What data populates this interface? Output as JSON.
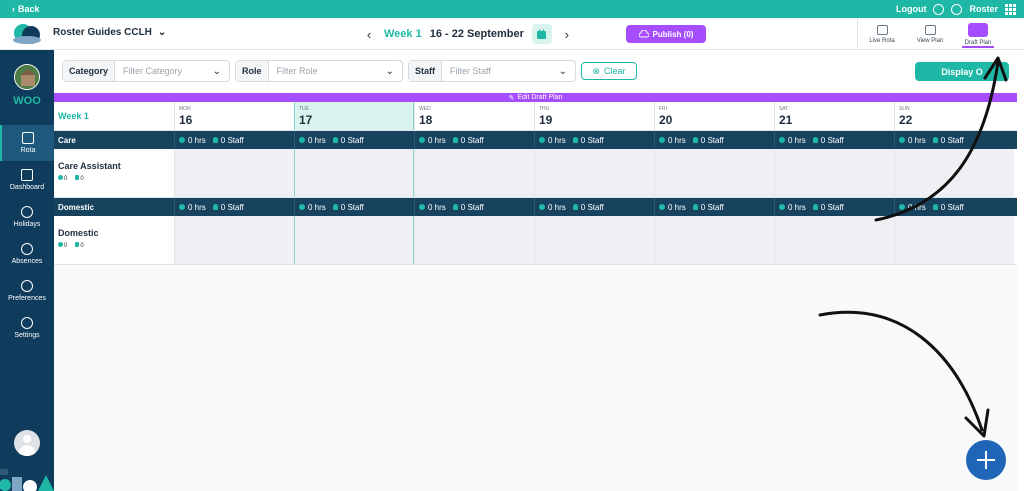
{
  "topbar": {
    "back_label": "Back",
    "logout_label": "Logout",
    "roster_label": "Roster"
  },
  "header": {
    "org_name": "Roster Guides CCLH",
    "week_label": "Week 1",
    "date_range": "16 - 22 September",
    "publish_label": "Publish (0)",
    "view_tabs": [
      {
        "label": "Live Rota",
        "active": false
      },
      {
        "label": "View Plan",
        "active": false
      },
      {
        "label": "Draft Plan",
        "active": true
      }
    ]
  },
  "sidebar": {
    "brand": "WOO",
    "items": [
      {
        "label": "Rota",
        "icon": "calendar-icon",
        "active": true
      },
      {
        "label": "Dashboard",
        "icon": "dashboard-icon",
        "active": false
      },
      {
        "label": "Holidays",
        "icon": "beach-icon",
        "active": false
      },
      {
        "label": "Absences",
        "icon": "absence-icon",
        "active": false
      },
      {
        "label": "Preferences",
        "icon": "preferences-icon",
        "active": false
      },
      {
        "label": "Settings",
        "icon": "gear-icon",
        "active": false
      }
    ]
  },
  "filters": {
    "category": {
      "label": "Category",
      "placeholder": "Filter Category"
    },
    "role": {
      "label": "Role",
      "placeholder": "Filter Role"
    },
    "staff": {
      "label": "Staff",
      "placeholder": "Filter Staff"
    },
    "clear_label": "Clear",
    "display_label": "Display O"
  },
  "draft_strip_label": "Edit Draft Plan",
  "grid": {
    "week_label": "Week 1",
    "days": [
      {
        "name": "MON",
        "num": "16"
      },
      {
        "name": "TUE",
        "num": "17"
      },
      {
        "name": "WED",
        "num": "18"
      },
      {
        "name": "THU",
        "num": "19"
      },
      {
        "name": "FRI",
        "num": "20"
      },
      {
        "name": "SAT",
        "num": "21"
      },
      {
        "name": "SUN",
        "num": "22"
      }
    ],
    "today_index": 1,
    "cell_hours": "0 hrs",
    "cell_staff": "0 Staff",
    "categories": [
      {
        "name": "Care",
        "role": "Care Assistant",
        "meta_a": "0",
        "meta_b": "0"
      },
      {
        "name": "Domestic",
        "role": "Domestic",
        "meta_a": "0",
        "meta_b": "0"
      }
    ]
  },
  "colors": {
    "teal": "#1fb8a6",
    "navy": "#0f3b5c",
    "purple": "#a64dff",
    "fab_blue": "#1f66b8"
  }
}
